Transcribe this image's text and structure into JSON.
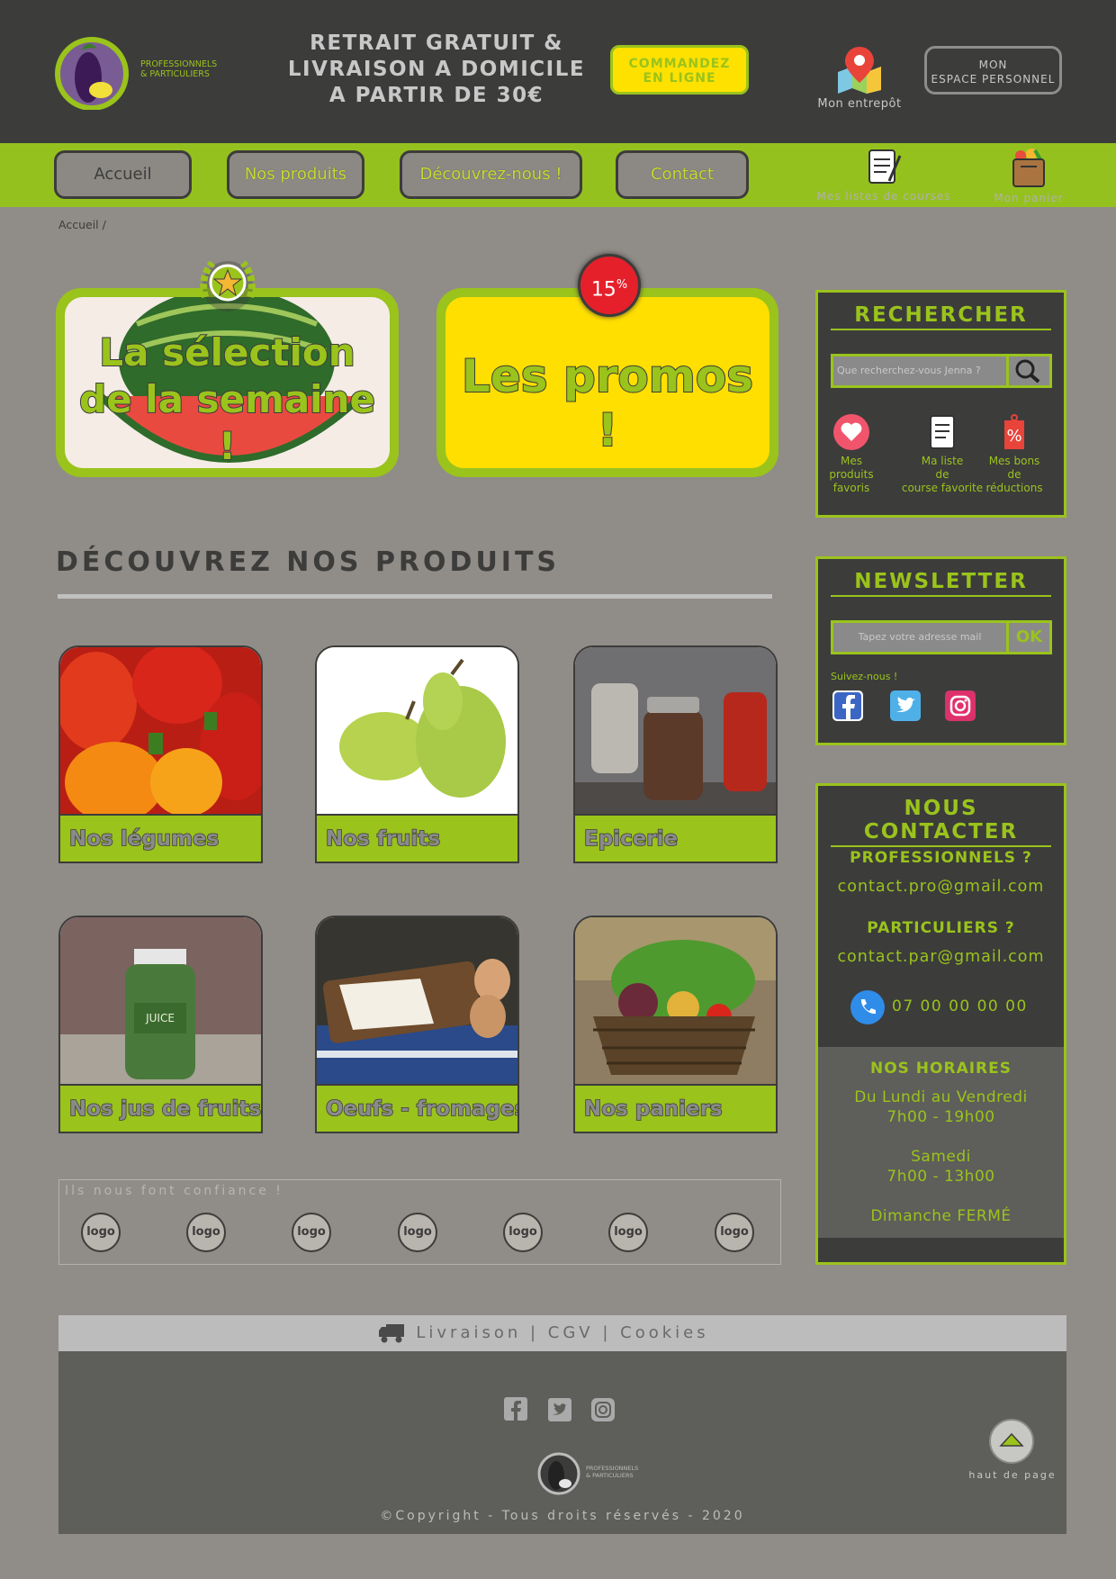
{
  "header": {
    "logo_line1": "PROFESSIONNELS",
    "logo_line2": "& PARTICULIERS",
    "tagline_1": "RETRAIT GRATUIT &",
    "tagline_2": "LIVRAISON A DOMICILE",
    "tagline_3": "A PARTIR DE 30€",
    "order_line1": "COMMANDEZ",
    "order_line2": "EN LIGNE",
    "warehouse_label": "Mon entrepôt",
    "account_line1": "MON",
    "account_line2": "ESPACE PERSONNEL"
  },
  "nav": {
    "items": [
      "Accueil",
      "Nos produits",
      "Découvrez-nous !",
      "Contact"
    ],
    "lists_label": "Mes listes de courses",
    "cart_label": "Mon panier"
  },
  "breadcrumb": "Accueil /",
  "promos": {
    "week_line1": "La sélection",
    "week_line2": "de la semaine !",
    "sales": "Les promos !",
    "badge_num": "15",
    "badge_pct": "%"
  },
  "products": {
    "title": "DÉCOUVREZ NOS PRODUITS",
    "items": [
      "Nos légumes",
      "Nos fruits",
      "Epicerie",
      "Nos jus de fruits",
      "Oeufs - fromages",
      "Nos paniers"
    ]
  },
  "trust": {
    "title": "Ils nous font confiance !",
    "logo_label": "logo"
  },
  "search": {
    "title": "RECHERCHER",
    "placeholder": "Que recherchez-vous Jenna ?",
    "quick": [
      {
        "line1": "Mes",
        "line2": "produits",
        "line3": "favoris"
      },
      {
        "line1": "Ma liste",
        "line2": "de",
        "line3": "course favorite"
      },
      {
        "line1": "Mes bons",
        "line2": "de",
        "line3": "réductions"
      }
    ]
  },
  "newsletter": {
    "title": "NEWSLETTER",
    "placeholder": "Tapez votre adresse mail",
    "ok": "OK",
    "follow": "Suivez-nous !"
  },
  "contact": {
    "title": "NOUS CONTACTER",
    "pro_label": "PROFESSIONNELS ?",
    "pro_email": "contact.pro@gmail.com",
    "part_label": "PARTICULIERS ?",
    "part_email": "contact.par@gmail.com",
    "phone": "07 00 00 00 00",
    "hours_title": "NOS HORAIRES",
    "hours_week": "Du Lundi au Vendredi",
    "hours_week_time": "7h00 - 19h00",
    "hours_sat": "Samedi",
    "hours_sat_time": "7h00 - 13h00",
    "hours_sun": "Dimanche FERMÉ"
  },
  "footer": {
    "links": "Livraison | CGV | Cookies",
    "copyright": "©Copyright - Tous droits réservés - 2020",
    "top_label": "haut de page",
    "logo_line1": "PROFESSIONNELS",
    "logo_line2": "& PARTICULIERS"
  },
  "colors": {
    "dark": "#3c3c3b",
    "green": "#9ac31c",
    "yellow": "#ffe100",
    "background": "#908c87"
  }
}
